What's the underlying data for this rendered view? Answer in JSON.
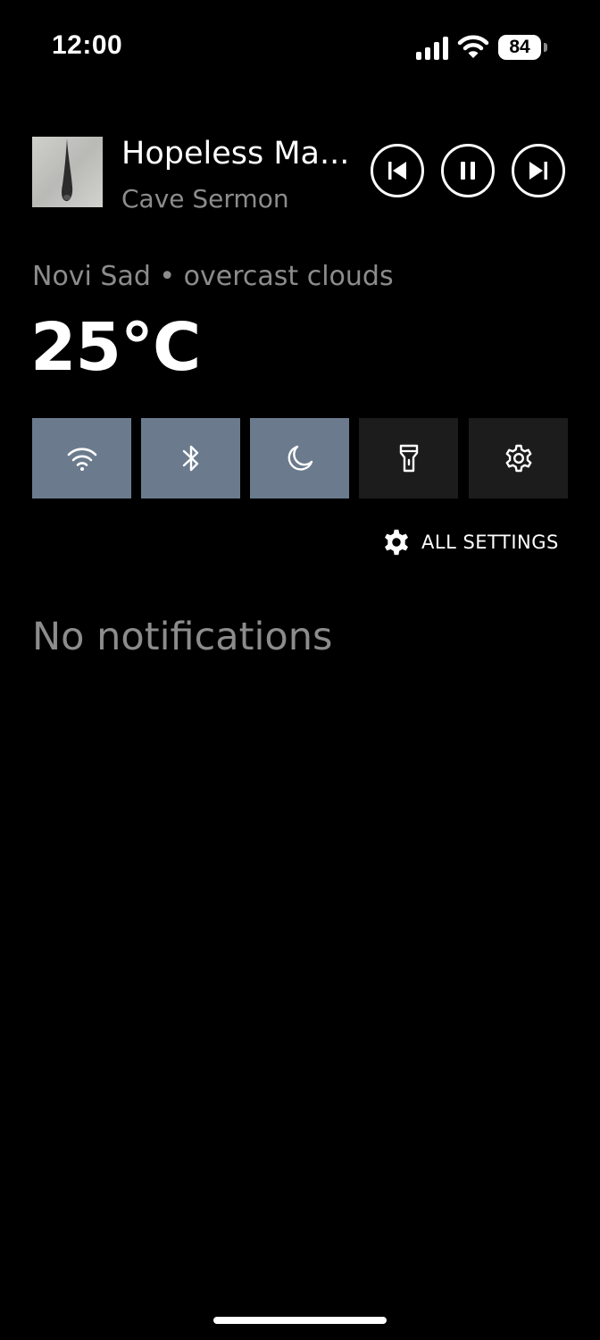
{
  "status_bar": {
    "time": "12:00",
    "battery_level": "84",
    "icons": [
      "signal-icon",
      "wifi-icon",
      "battery-icon"
    ]
  },
  "media": {
    "title": "Hopeless Ma...",
    "artist": "Cave Sermon",
    "controls": [
      "previous-icon",
      "pause-icon",
      "next-icon"
    ]
  },
  "weather": {
    "location": "Novi Sad • overcast clouds",
    "temperature": "25°C"
  },
  "quick_tiles": [
    {
      "icon": "wifi-icon",
      "active": true
    },
    {
      "icon": "bluetooth-icon",
      "active": true
    },
    {
      "icon": "moon-icon",
      "active": true
    },
    {
      "icon": "flashlight-icon",
      "active": false
    },
    {
      "icon": "settings-icon",
      "active": false
    }
  ],
  "all_settings": {
    "label": "ALL SETTINGS",
    "icon": "gear-icon"
  },
  "notifications": {
    "empty_text": "No notifications"
  },
  "colors": {
    "background": "#000000",
    "tile_active": "#6b7b8d",
    "tile_inactive": "#1c1c1c",
    "secondary_text": "#8c8c8c"
  }
}
